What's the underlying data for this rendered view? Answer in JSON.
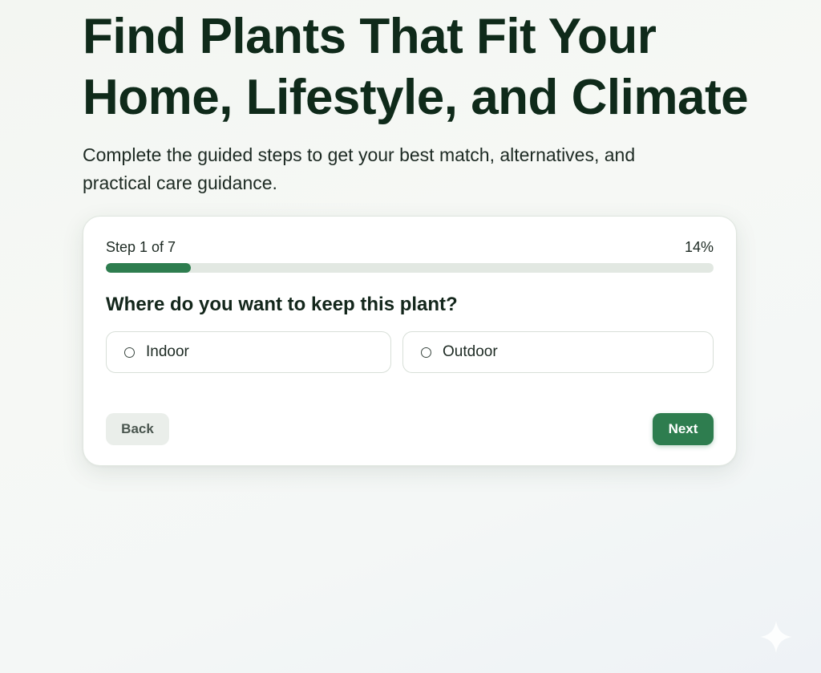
{
  "hero": {
    "title": "Find Plants That Fit Your Home, Lifestyle, and Climate",
    "subtitle": "Complete the guided steps to get your best match, alternatives, and practical care guidance."
  },
  "wizard": {
    "step_label": "Step 1 of 7",
    "percent_label": "14%",
    "progress_fraction": 0.14,
    "question": "Where do you want to keep this plant?",
    "options": [
      {
        "label": "Indoor",
        "selected": false
      },
      {
        "label": "Outdoor",
        "selected": false
      }
    ],
    "back_label": "Back",
    "next_label": "Next"
  },
  "colors": {
    "accent": "#2e7d4f",
    "heading": "#0f2a1a",
    "track": "#e2e8e2"
  },
  "icons": {
    "option_indicator": "radio-unchecked-icon",
    "corner_mark": "sparkle-icon"
  }
}
